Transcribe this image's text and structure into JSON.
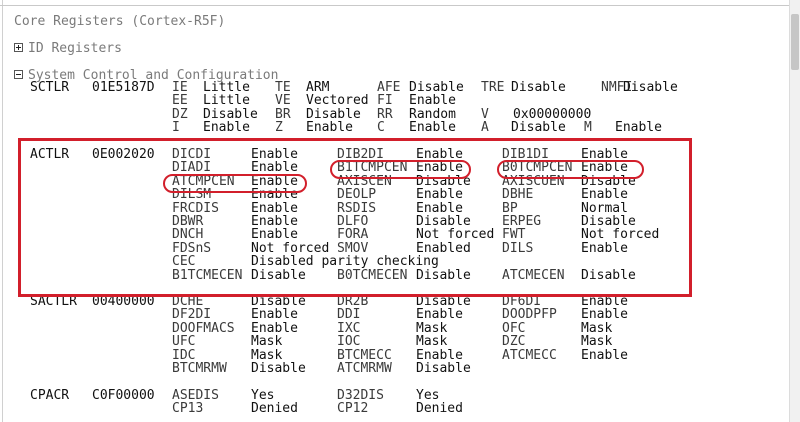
{
  "window": {
    "title": "Core Registers (Cortex-R5F)"
  },
  "groups": {
    "id_registers": "ID Registers",
    "system_control": "System Control and Configuration"
  },
  "registers": {
    "sctlr": {
      "name": "SCTLR",
      "value": "01E5187D",
      "rows": [
        [
          [
            "IE",
            "Little"
          ],
          [
            "TE",
            "ARM"
          ],
          [
            "AFE",
            "Disable"
          ],
          [
            "TRE",
            "Disable"
          ],
          [
            "NMFI",
            "Disable"
          ]
        ],
        [
          [
            "EE",
            "Little"
          ],
          [
            "VE",
            "Vectored"
          ],
          [
            "FI",
            "Enable"
          ]
        ],
        [
          [
            "DZ",
            "Disable"
          ],
          [
            "BR",
            "Disable"
          ],
          [
            "RR",
            "Random"
          ],
          [
            "V",
            "0x00000000"
          ]
        ],
        [
          [
            "I",
            "Enable"
          ],
          [
            "Z",
            "Enable"
          ],
          [
            "C",
            "Enable"
          ],
          [
            "A",
            "Disable"
          ],
          [
            "M",
            "Enable"
          ]
        ]
      ]
    },
    "actlr": {
      "name": "ACTLR",
      "value": "0E002020",
      "rows": [
        [
          [
            "DICDI",
            "Enable"
          ],
          [
            "DIB2DI",
            "Enable"
          ],
          [
            "DIB1DI",
            "Enable"
          ]
        ],
        [
          [
            "DIADI",
            "Enable"
          ],
          [
            "B1TCMPCEN",
            "Enable"
          ],
          [
            "B0TCMPCEN",
            "Enable"
          ]
        ],
        [
          [
            "ATCMPCEN",
            "Enable"
          ],
          [
            "AXISCEN",
            "Disable"
          ],
          [
            "AXISCUEN",
            "Disable"
          ]
        ],
        [
          [
            "DILSM",
            "Enable"
          ],
          [
            "DEOLP",
            "Enable"
          ],
          [
            "DBHE",
            "Enable"
          ]
        ],
        [
          [
            "FRCDIS",
            "Enable"
          ],
          [
            "RSDIS",
            "Enable"
          ],
          [
            "BP",
            "Normal"
          ]
        ],
        [
          [
            "DBWR",
            "Enable"
          ],
          [
            "DLFO",
            "Disable"
          ],
          [
            "ERPEG",
            "Disable"
          ]
        ],
        [
          [
            "DNCH",
            "Enable"
          ],
          [
            "FORA",
            "Not forced"
          ],
          [
            "FWT",
            "Not forced"
          ]
        ],
        [
          [
            "FDSnS",
            "Not forced"
          ],
          [
            "SMOV",
            "Enabled"
          ],
          [
            "DILS",
            "Enable"
          ]
        ],
        [
          [
            "CEC",
            "Disabled parity checking"
          ]
        ],
        [
          [
            "B1TCMECEN",
            "Disable"
          ],
          [
            "B0TCMECEN",
            "Disable"
          ],
          [
            "ATCMECEN",
            "Disable"
          ]
        ]
      ]
    },
    "sactlr": {
      "name": "SACTLR",
      "value": "00400000",
      "rows": [
        [
          [
            "DCHE",
            "Disable"
          ],
          [
            "DR2B",
            "Disable"
          ],
          [
            "DF6DI",
            "Enable"
          ]
        ],
        [
          [
            "DF2DI",
            "Enable"
          ],
          [
            "DDI",
            "Enable"
          ],
          [
            "DOODPFP",
            "Enable"
          ]
        ],
        [
          [
            "DOOFMACS",
            "Enable"
          ],
          [
            "IXC",
            "Mask"
          ],
          [
            "OFC",
            "Mask"
          ]
        ],
        [
          [
            "UFC",
            "Mask"
          ],
          [
            "IOC",
            "Mask"
          ],
          [
            "DZC",
            "Mask"
          ]
        ],
        [
          [
            "IDC",
            "Mask"
          ],
          [
            "BTCMECC",
            "Enable"
          ],
          [
            "ATCMECC",
            "Enable"
          ]
        ],
        [
          [
            "BTCMRMW",
            "Disable"
          ],
          [
            "ATCMRMW",
            "Disable"
          ]
        ]
      ]
    },
    "cpacr": {
      "name": "CPACR",
      "value": "C0F00000",
      "rows": [
        [
          [
            "ASEDIS",
            "Yes"
          ],
          [
            "D32DIS",
            "Yes"
          ]
        ],
        [
          [
            "CP13",
            "Denied"
          ],
          [
            "CP12",
            "Denied"
          ]
        ]
      ]
    }
  }
}
